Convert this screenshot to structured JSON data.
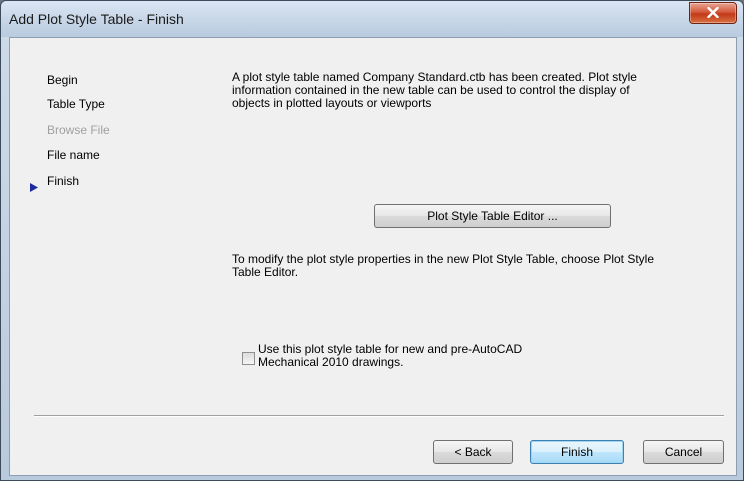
{
  "window": {
    "title": "Add Plot Style Table - Finish",
    "close_icon": "close-icon"
  },
  "steps": [
    {
      "label": "Begin",
      "state": "normal"
    },
    {
      "label": "Table Type",
      "state": "normal"
    },
    {
      "label": "Browse File",
      "state": "disabled"
    },
    {
      "label": "File name",
      "state": "normal"
    },
    {
      "label": "Finish",
      "state": "current"
    }
  ],
  "main": {
    "description": "A plot style table named Company Standard.ctb has been created. Plot style information contained in the new table can be used to control the display of objects in plotted layouts or viewports",
    "editor_button": "Plot Style Table Editor ...",
    "modify_text": "To modify the plot style properties in the new Plot Style Table, choose Plot Style Table Editor.",
    "checkbox_label": "Use this plot style table for new and pre-AutoCAD Mechanical 2010 drawings.",
    "checkbox_checked": false
  },
  "footer": {
    "back": "< Back",
    "finish": "Finish",
    "cancel": "Cancel"
  },
  "colors": {
    "current_step_arrow": "#1b2a9e",
    "close_button": "#c8401f"
  }
}
